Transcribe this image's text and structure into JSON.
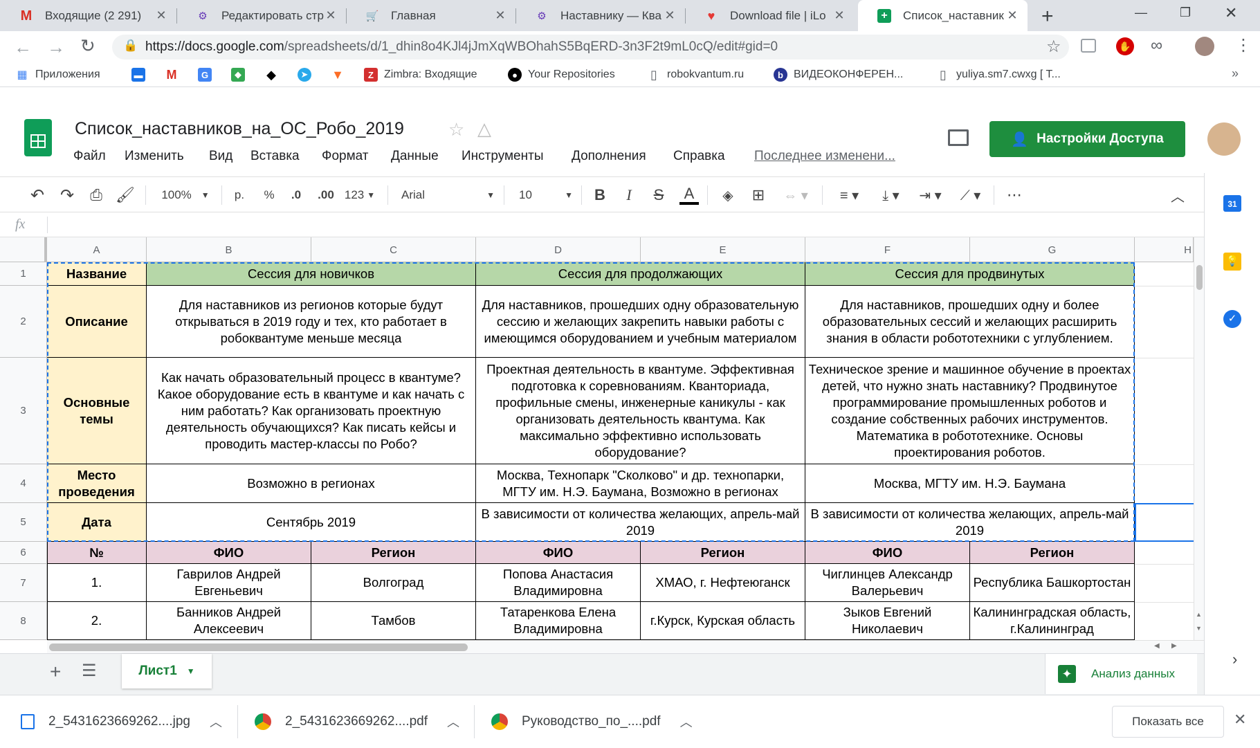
{
  "browser": {
    "tabs": [
      {
        "title": "Входящие (2 291)",
        "icon": "gmail-icon"
      },
      {
        "title": "Редактировать стр",
        "icon": "quiz-icon"
      },
      {
        "title": "Главная",
        "icon": "cart-icon"
      },
      {
        "title": "Наставнику — Ква",
        "icon": "quiz-icon"
      },
      {
        "title": "Download file | iLo",
        "icon": "heart-icon"
      },
      {
        "title": "Список_наставник",
        "icon": "sheets-icon"
      }
    ],
    "url_host": "https://docs.google.com",
    "url_path": "/spreadsheets/d/1_dhin8o4KJl4jJmXqWBOhahS5BqERD-3n3F2t9mL0cQ/edit#gid=0",
    "bookmarks": [
      {
        "label": "Приложения",
        "icon": "apps-icon"
      },
      {
        "label": "",
        "icon": "chat-icon"
      },
      {
        "label": "",
        "icon": "gmail-icon"
      },
      {
        "label": "",
        "icon": "translate-icon"
      },
      {
        "label": "",
        "icon": "maps-icon"
      },
      {
        "label": "",
        "icon": "ttt-icon"
      },
      {
        "label": "",
        "icon": "telegram-icon"
      },
      {
        "label": "",
        "icon": "gitlab-icon"
      },
      {
        "label": "Zimbra: Входящие",
        "icon": "zimbra-icon"
      },
      {
        "label": "Your Repositories",
        "icon": "github-icon"
      },
      {
        "label": "robokvantum.ru",
        "icon": "page-icon"
      },
      {
        "label": "ВИДЕОКОНФЕРЕН...",
        "icon": "b-icon"
      },
      {
        "label": "yuliya.sm7.cwxg [ T...",
        "icon": "page-icon"
      }
    ]
  },
  "sheets": {
    "title": "Список_наставников_на_ОС_Робо_2019",
    "menu": [
      "Файл",
      "Изменить",
      "Вид",
      "Вставка",
      "Формат",
      "Данные",
      "Инструменты",
      "Дополнения",
      "Справка"
    ],
    "last_edit": "Последнее изменени...",
    "share_label": "Настройки Доступа",
    "toolbar": {
      "zoom": "100%",
      "currency": "р.",
      "percent": "%",
      "dec_less": ".0",
      "dec_more": ".00",
      "format_more": "123",
      "font": "Arial",
      "font_size": "10"
    },
    "fx": "fx"
  },
  "grid": {
    "columns": [
      "A",
      "B",
      "C",
      "D",
      "E",
      "F",
      "G",
      "H"
    ],
    "rows": [
      "1",
      "2",
      "3",
      "4",
      "5",
      "6",
      "7",
      "8"
    ],
    "r1": {
      "a": "Название",
      "bc": "Сессия для новичков",
      "de": "Сессия для продолжающих",
      "fg": "Сессия для продвинутых"
    },
    "r2": {
      "a": "Описание",
      "bc": "Для наставников из регионов которые будут открываться в 2019 году и тех, кто работает в робоквантуме меньше месяца",
      "de": "Для наставников, прошедших одну образовательную сессию и желающих закрепить навыки работы с имеющимся оборудованием и учебным материалом",
      "fg": "Для наставников, прошедших одну и более образовательных сессий и желающих расширить знания в области робототехники с углублением."
    },
    "r3": {
      "a": "Основные темы",
      "bc": "Как начать образовательный процесс в квантуме? Какое оборудование есть в квантуме и как начать с ним работать? Как организовать проектную деятельность обучающихся? Как писать кейсы и проводить мастер-классы по Робо?",
      "de": "Проектная деятельность в квантуме. Эффективная подготовка к соревнованиям. Кванториада, профильные смены, инженерные каникулы - как организовать деятельность квантума. Как максимально эффективно использовать оборудование?",
      "fg": "Техническое зрение и машинное обучение в проектах детей, что нужно знать наставнику? Продвинутое программирование промышленных роботов и создание собственных рабочих инструментов. Математика в робототехнике. Основы проектирования роботов."
    },
    "r4": {
      "a": "Место проведения",
      "bc": "Возможно в регионах",
      "de": "Москва, Технопарк \"Сколково\" и др. технопарки, МГТУ им. Н.Э. Баумана, Возможно в регионах",
      "fg": "Москва, МГТУ им. Н.Э. Баумана"
    },
    "r5": {
      "a": "Дата",
      "bc": "Сентябрь 2019",
      "de": "В зависимости от количества желающих, апрель-май 2019",
      "fg": "В зависимости от количества желающих, апрель-май 2019"
    },
    "r6": [
      "№",
      "ФИО",
      "Регион",
      "ФИО",
      "Регион",
      "ФИО",
      "Регион"
    ],
    "r7": [
      "1.",
      "Гаврилов Андрей Евгеньевич",
      "Волгоград",
      "Попова Анастасия Владимировна",
      "ХМАО, г. Нефтеюганск",
      "Чиглинцев Александр Валерьевич",
      "Республика Башкортостан"
    ],
    "r8": [
      "2.",
      "Банников Андрей Алексеевич",
      "Тамбов",
      "Татаренкова Елена Владимировна",
      "г.Курск, Курская область",
      "Зыков Евгений Николаевич",
      "Калининградская область, г.Калининград"
    ]
  },
  "sheet_tabs": {
    "active": "Лист1",
    "explore": "Анализ данных"
  },
  "downloads": {
    "items": [
      {
        "name": "2_5431623669262....jpg",
        "icon": "image-file-icon"
      },
      {
        "name": "2_5431623669262....pdf",
        "icon": "chrome-icon"
      },
      {
        "name": "Руководство_по_....pdf",
        "icon": "chrome-icon"
      }
    ],
    "show_all": "Показать все"
  },
  "colors": {
    "label_bg": "#fff2cc",
    "session_bg": "#b6d7a8",
    "table_header_bg": "#ead1dc",
    "share_green": "#1e8e3e"
  }
}
